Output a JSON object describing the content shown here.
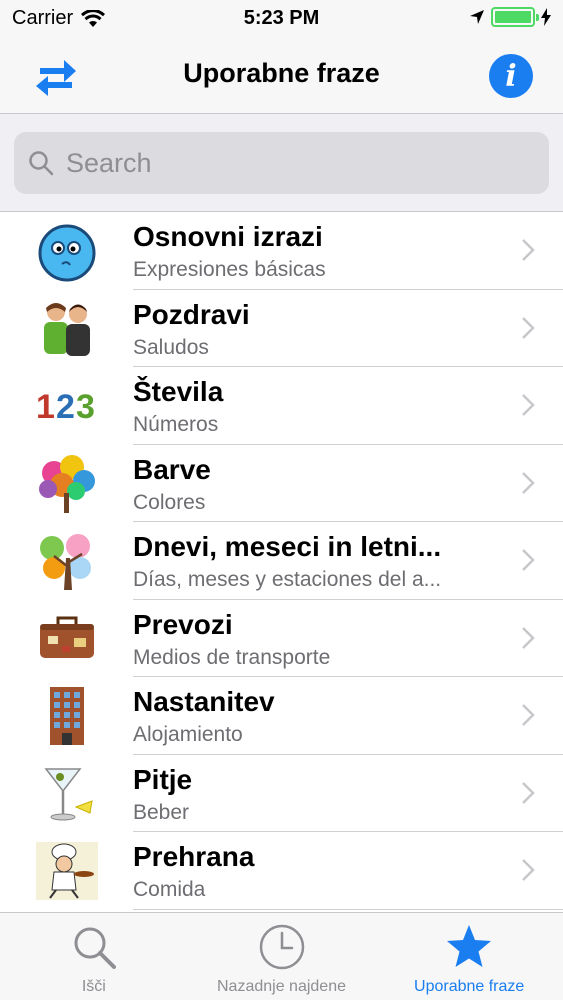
{
  "status_bar": {
    "carrier": "Carrier",
    "time": "5:23 PM"
  },
  "nav": {
    "title": "Uporabne fraze",
    "left_icon": "swap-arrows-icon",
    "right_icon": "info-icon",
    "right_glyph": "i"
  },
  "search": {
    "placeholder": "Search"
  },
  "list": [
    {
      "title": "Osnovni izrazi",
      "subtitle": "Expresiones básicas",
      "icon": "smiley-face-icon"
    },
    {
      "title": "Pozdravi",
      "subtitle": "Saludos",
      "icon": "greeting-people-icon"
    },
    {
      "title": "Števila",
      "subtitle": "Números",
      "icon": "numbers-123-icon",
      "icon_text": "123"
    },
    {
      "title": "Barve",
      "subtitle": "Colores",
      "icon": "color-tree-icon"
    },
    {
      "title": "Dnevi, meseci in letni...",
      "subtitle": "Días, meses y estaciones del a...",
      "icon": "seasons-tree-icon"
    },
    {
      "title": "Prevozi",
      "subtitle": "Medios de transporte",
      "icon": "suitcase-icon"
    },
    {
      "title": "Nastanitev",
      "subtitle": "Alojamiento",
      "icon": "hotel-building-icon"
    },
    {
      "title": "Pitje",
      "subtitle": "Beber",
      "icon": "cocktail-glass-icon"
    },
    {
      "title": "Prehrana",
      "subtitle": "Comida",
      "icon": "chef-icon"
    }
  ],
  "tabs": [
    {
      "label": "Išči",
      "icon": "search-icon",
      "active": false
    },
    {
      "label": "Nazadnje najdene",
      "icon": "clock-icon",
      "active": false
    },
    {
      "label": "Uporabne fraze",
      "icon": "star-icon",
      "active": true
    }
  ],
  "colors": {
    "accent": "#1a7ef0",
    "battery": "#4cd964",
    "inactive": "#8e8e93"
  }
}
